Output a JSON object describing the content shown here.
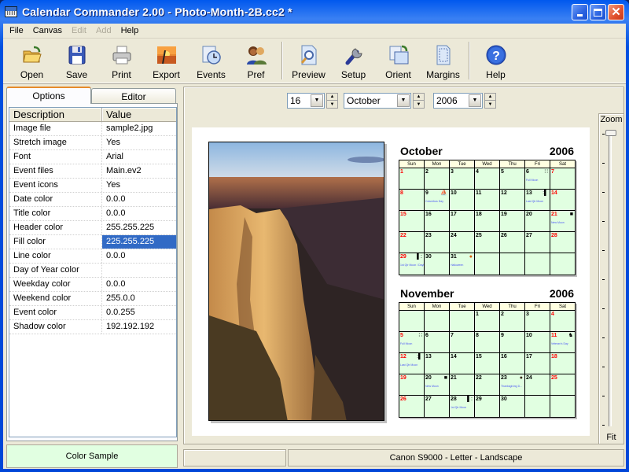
{
  "window": {
    "title": "Calendar Commander 2.00 - Photo-Month-2B.cc2 *",
    "controls": [
      "minimize",
      "maximize",
      "close"
    ]
  },
  "menubar": [
    {
      "label": "File",
      "enabled": true
    },
    {
      "label": "Canvas",
      "enabled": true
    },
    {
      "label": "Edit",
      "enabled": false
    },
    {
      "label": "Add",
      "enabled": false
    },
    {
      "label": "Help",
      "enabled": true
    }
  ],
  "toolbar": {
    "group1": [
      {
        "label": "Open",
        "icon": "folder-open-icon"
      },
      {
        "label": "Save",
        "icon": "floppy-disk-icon"
      },
      {
        "label": "Print",
        "icon": "printer-icon"
      },
      {
        "label": "Export",
        "icon": "export-image-icon"
      },
      {
        "label": "Events",
        "icon": "events-clock-icon"
      },
      {
        "label": "Pref",
        "icon": "preferences-users-icon"
      }
    ],
    "group2": [
      {
        "label": "Preview",
        "icon": "preview-magnifier-icon"
      },
      {
        "label": "Setup",
        "icon": "wrench-icon"
      },
      {
        "label": "Orient",
        "icon": "orient-pages-icon"
      },
      {
        "label": "Margins",
        "icon": "margins-page-icon"
      }
    ],
    "group3": [
      {
        "label": "Help",
        "icon": "help-question-icon"
      }
    ]
  },
  "tabs": {
    "options": "Options",
    "editor": "Editor",
    "active": "Options"
  },
  "properties": {
    "headers": {
      "description": "Description",
      "value": "Value"
    },
    "rows": [
      {
        "description": "Image file",
        "value": "sample2.jpg"
      },
      {
        "description": "Stretch image",
        "value": "Yes"
      },
      {
        "description": "Font",
        "value": "Arial"
      },
      {
        "description": "Event files",
        "value": "Main.ev2"
      },
      {
        "description": "Event icons",
        "value": "Yes"
      },
      {
        "description": "Date color",
        "value": "0.0.0"
      },
      {
        "description": "Title color",
        "value": "0.0.0"
      },
      {
        "description": "Header color",
        "value": "255.255.225"
      },
      {
        "description": "Fill color",
        "value": "225.255.225",
        "selected": true
      },
      {
        "description": "Line color",
        "value": "0.0.0"
      },
      {
        "description": "Day of Year color",
        "value": ""
      },
      {
        "description": "Weekday color",
        "value": "0.0.0"
      },
      {
        "description": "Weekend color",
        "value": "255.0.0"
      },
      {
        "description": "Event color",
        "value": "0.0.255"
      },
      {
        "description": "Shadow color",
        "value": "192.192.192"
      }
    ]
  },
  "color_sample": {
    "label": "Color Sample",
    "color": "#e1ffe1"
  },
  "date_selector": {
    "day": "16",
    "month": "October",
    "year": "2006"
  },
  "zoom": {
    "label": "Zoom",
    "fit_label": "Fit",
    "level": 0
  },
  "statusbar": {
    "left": "",
    "printer": "Canon S9000 - Letter - Landscape"
  },
  "colors": {
    "header_fill": "#ffffe1",
    "cell_fill": "#e1ffe1",
    "weekend": "#ff0000",
    "event": "#0000ff",
    "shadow": "#c0c0c0",
    "selection": "#316ac5"
  },
  "calendars": [
    {
      "month": "October",
      "year": "2006",
      "weekdays": [
        "Sun",
        "Mon",
        "Tue",
        "Wed",
        "Thu",
        "Fri",
        "Sat"
      ],
      "weeks": [
        [
          {
            "d": "1"
          },
          {
            "d": "2"
          },
          {
            "d": "3"
          },
          {
            "d": "4"
          },
          {
            "d": "5"
          },
          {
            "d": "6",
            "event": "Full Moon",
            "icon": "::"
          },
          {
            "d": "7"
          }
        ],
        [
          {
            "d": "8"
          },
          {
            "d": "9",
            "event": "Columbus Day",
            "icon": "ship"
          },
          {
            "d": "10"
          },
          {
            "d": "11"
          },
          {
            "d": "12"
          },
          {
            "d": "13",
            "event": "Last Qtr Moon",
            "icon": ":█"
          },
          {
            "d": "14"
          }
        ],
        [
          {
            "d": "15"
          },
          {
            "d": "16"
          },
          {
            "d": "17"
          },
          {
            "d": "18"
          },
          {
            "d": "19"
          },
          {
            "d": "20"
          },
          {
            "d": "21",
            "event": "New Moon",
            "icon": "■"
          }
        ],
        [
          {
            "d": "22"
          },
          {
            "d": "23"
          },
          {
            "d": "24"
          },
          {
            "d": "25"
          },
          {
            "d": "26"
          },
          {
            "d": "27"
          },
          {
            "d": "28"
          }
        ],
        [
          {
            "d": "29",
            "event": "1st Qtr Moon / Daylight Time ...",
            "icon": "█:"
          },
          {
            "d": "30"
          },
          {
            "d": "31",
            "event": "Halloween",
            "icon": "pumpkin"
          },
          {
            "d": ""
          },
          {
            "d": ""
          },
          {
            "d": ""
          },
          {
            "d": ""
          }
        ]
      ]
    },
    {
      "month": "November",
      "year": "2006",
      "weekdays": [
        "Sun",
        "Mon",
        "Tue",
        "Wed",
        "Thu",
        "Fri",
        "Sat"
      ],
      "weeks": [
        [
          {
            "d": ""
          },
          {
            "d": ""
          },
          {
            "d": ""
          },
          {
            "d": "1"
          },
          {
            "d": "2"
          },
          {
            "d": "3"
          },
          {
            "d": "4"
          }
        ],
        [
          {
            "d": "5",
            "event": "Full Moon",
            "icon": "::"
          },
          {
            "d": "6"
          },
          {
            "d": "7"
          },
          {
            "d": "8"
          },
          {
            "d": "9"
          },
          {
            "d": "10"
          },
          {
            "d": "11",
            "event": "Veteran's Day",
            "icon": "soldier"
          }
        ],
        [
          {
            "d": "12",
            "event": "Last Qtr Moon",
            "icon": ":█"
          },
          {
            "d": "13"
          },
          {
            "d": "14"
          },
          {
            "d": "15"
          },
          {
            "d": "16"
          },
          {
            "d": "17"
          },
          {
            "d": "18"
          }
        ],
        [
          {
            "d": "19"
          },
          {
            "d": "20",
            "event": "New Moon",
            "icon": "■"
          },
          {
            "d": "21"
          },
          {
            "d": "22"
          },
          {
            "d": "23",
            "event": "Thanksgiving D...",
            "icon": "turkey"
          },
          {
            "d": "24"
          },
          {
            "d": "25"
          }
        ],
        [
          {
            "d": "26"
          },
          {
            "d": "27"
          },
          {
            "d": "28",
            "event": "1st Qtr Moon",
            "icon": "█:"
          },
          {
            "d": "29"
          },
          {
            "d": "30"
          },
          {
            "d": ""
          },
          {
            "d": ""
          }
        ]
      ]
    }
  ]
}
